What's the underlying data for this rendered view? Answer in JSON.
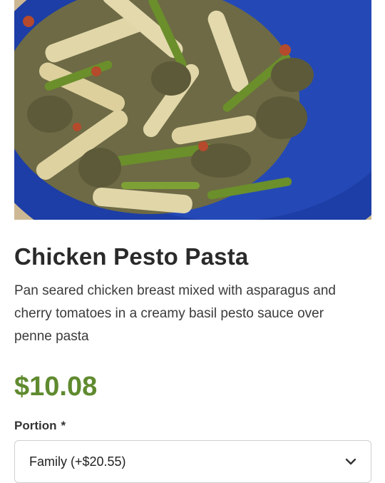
{
  "item": {
    "title": "Chicken Pesto Pasta",
    "description": "Pan seared chicken breast mixed with asparagus and cherry tomatoes in a creamy basil pesto sauce over penne pasta",
    "price": "$10.08",
    "photo_icon": "pasta-dish-photo"
  },
  "portion": {
    "label": "Portion",
    "required_marker": "*",
    "selected": "Family (+$20.55)",
    "icon": "chevron-down-icon"
  },
  "colors": {
    "price": "#5f8a2f",
    "plate": "#1d3ea6"
  }
}
